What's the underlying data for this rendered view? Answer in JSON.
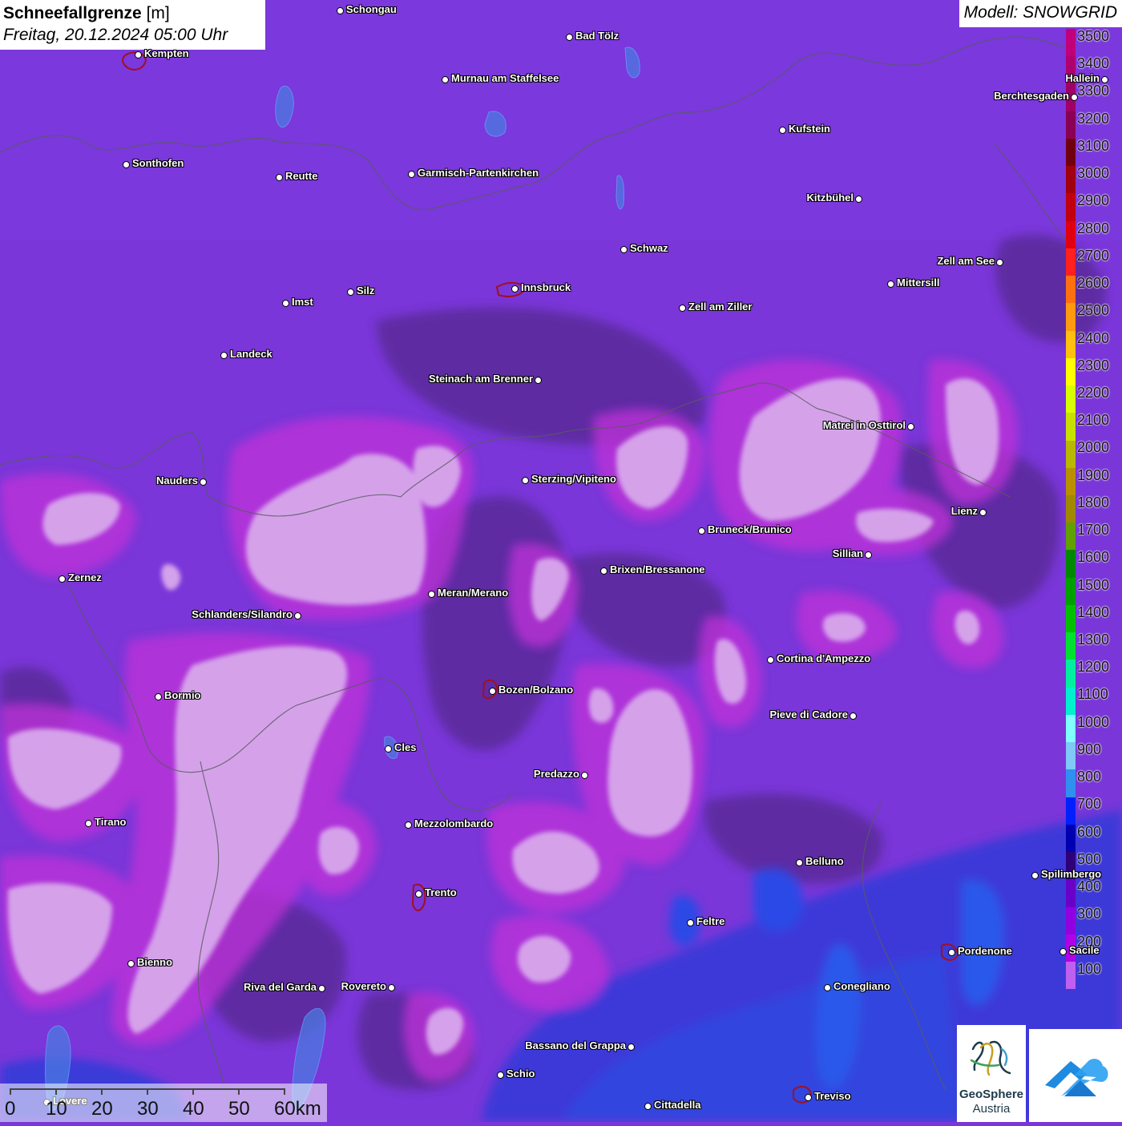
{
  "title": {
    "main": "Schneefallgrenze",
    "unit": "[m]",
    "datetime": "Freitag, 20.12.2024 05:00 Uhr"
  },
  "model": "Modell: SNOWGRID",
  "legend": {
    "labels": [
      "3500",
      "3400",
      "3300",
      "3200",
      "3100",
      "3000",
      "2900",
      "2800",
      "2700",
      "2600",
      "2500",
      "2400",
      "2300",
      "2200",
      "2100",
      "2000",
      "1900",
      "1800",
      "1700",
      "1600",
      "1500",
      "1400",
      "1300",
      "1200",
      "1100",
      "1000",
      "900",
      "800",
      "700",
      "600",
      "500",
      "400",
      "300",
      "200",
      "100"
    ],
    "colors": [
      "#c0007a",
      "#b00070",
      "#a00065",
      "#8a0055",
      "#700010",
      "#a00010",
      "#c00010",
      "#e00010",
      "#ff2020",
      "#ff7010",
      "#ff9a10",
      "#ffc010",
      "#ffff00",
      "#d8ff00",
      "#c8e000",
      "#b8b800",
      "#b89000",
      "#a08800",
      "#60a000",
      "#008800",
      "#00a000",
      "#00c000",
      "#00e030",
      "#00f0a0",
      "#00f0d0",
      "#80ffff",
      "#80c8f8",
      "#3090f0",
      "#0020ff",
      "#0000b0",
      "#30007a",
      "#6a00c8",
      "#9000e0",
      "#b000e8",
      "#c060f0"
    ]
  },
  "cities": [
    {
      "name": "Schongau",
      "label_side": "right"
    },
    {
      "name": "Bad Tölz",
      "label_side": "right"
    },
    {
      "name": "Kempten",
      "label_side": "right"
    },
    {
      "name": "Murnau am Staffelsee",
      "label_side": "right"
    },
    {
      "name": "Hallein",
      "label_side": "left"
    },
    {
      "name": "Berchtesgaden",
      "label_side": "left"
    },
    {
      "name": "Kufstein",
      "label_side": "right"
    },
    {
      "name": "Sonthofen",
      "label_side": "right"
    },
    {
      "name": "Reutte",
      "label_side": "right"
    },
    {
      "name": "Garmisch-Partenkirchen",
      "label_side": "right"
    },
    {
      "name": "Kitzbühel",
      "label_side": "left"
    },
    {
      "name": "Schwaz",
      "label_side": "right"
    },
    {
      "name": "Zell am See",
      "label_side": "left"
    },
    {
      "name": "Mittersill",
      "label_side": "right"
    },
    {
      "name": "Innsbruck",
      "label_side": "right"
    },
    {
      "name": "Imst",
      "label_side": "right"
    },
    {
      "name": "Silz",
      "label_side": "right"
    },
    {
      "name": "Zell am Ziller",
      "label_side": "right"
    },
    {
      "name": "Landeck",
      "label_side": "right"
    },
    {
      "name": "Steinach am Brenner",
      "label_side": "left"
    },
    {
      "name": "Matrei in Osttirol",
      "label_side": "left"
    },
    {
      "name": "Nauders",
      "label_side": "left"
    },
    {
      "name": "Sterzing/Vipiteno",
      "label_side": "right"
    },
    {
      "name": "Lienz",
      "label_side": "left"
    },
    {
      "name": "Bruneck/Brunico",
      "label_side": "right"
    },
    {
      "name": "Sillian",
      "label_side": "left"
    },
    {
      "name": "Brixen/Bressanone",
      "label_side": "right"
    },
    {
      "name": "Zernez",
      "label_side": "right"
    },
    {
      "name": "Meran/Merano",
      "label_side": "right"
    },
    {
      "name": "Schlanders/Silandro",
      "label_side": "left"
    },
    {
      "name": "Cortina d'Ampezzo",
      "label_side": "right"
    },
    {
      "name": "Bozen/Bolzano",
      "label_side": "right"
    },
    {
      "name": "Bormio",
      "label_side": "right"
    },
    {
      "name": "Pieve di Cadore",
      "label_side": "left"
    },
    {
      "name": "Cles",
      "label_side": "right"
    },
    {
      "name": "Predazzo",
      "label_side": "left"
    },
    {
      "name": "Tirano",
      "label_side": "right"
    },
    {
      "name": "Mezzolombardo",
      "label_side": "right"
    },
    {
      "name": "Belluno",
      "label_side": "right"
    },
    {
      "name": "Spilimbergo",
      "label_side": "right"
    },
    {
      "name": "Trento",
      "label_side": "right"
    },
    {
      "name": "Feltre",
      "label_side": "right"
    },
    {
      "name": "Pordenone",
      "label_side": "right"
    },
    {
      "name": "Sacile",
      "label_side": "right"
    },
    {
      "name": "Bienno",
      "label_side": "right"
    },
    {
      "name": "Riva del Garda",
      "label_side": "left"
    },
    {
      "name": "Rovereto",
      "label_side": "left"
    },
    {
      "name": "Conegliano",
      "label_side": "right"
    },
    {
      "name": "Bassano del Grappa",
      "label_side": "left"
    },
    {
      "name": "Schio",
      "label_side": "right"
    },
    {
      "name": "Treviso",
      "label_side": "right"
    },
    {
      "name": "Cittadella",
      "label_side": "right"
    },
    {
      "name": "Lovere",
      "label_side": "right"
    }
  ],
  "scalebar": {
    "labels": [
      "0",
      "10",
      "20",
      "30",
      "40",
      "50",
      "60km"
    ]
  },
  "logo": {
    "name": "GeoSphere",
    "subtitle": "Austria"
  }
}
